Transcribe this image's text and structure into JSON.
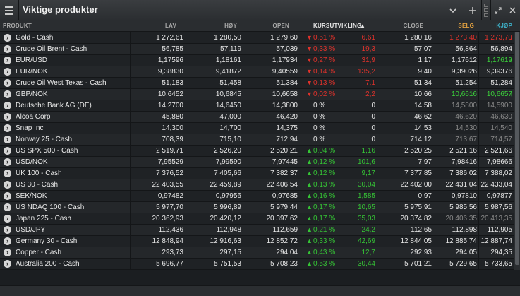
{
  "window": {
    "title": "Viktige produkter",
    "icons": [
      "menu-icon",
      "chevron-down-icon",
      "plus-icon",
      "expand-icon",
      "close-icon"
    ]
  },
  "columns": {
    "produkt": "PRODUKT",
    "lav": "LAV",
    "hoy": "HØY",
    "open": "OPEN",
    "kursutvikling": "KURSUTVIKLING",
    "close": "CLOSE",
    "selg": "SELG",
    "kjop": "KJØP"
  },
  "colors": {
    "up": "#35c435",
    "down": "#e0322b",
    "selg_header": "#e0a040",
    "kjop_header": "#3db0c8"
  },
  "rows": [
    {
      "name": "Gold - Cash",
      "lav": "1 272,61",
      "hoy": "1 280,50",
      "open": "1 279,60",
      "dir": "down",
      "pct": "0,51 %",
      "chg": "6,61",
      "close": "1 280,16",
      "selg": "1 273,40",
      "kjop": "1 273,70",
      "selg_state": "down",
      "kjop_state": "down"
    },
    {
      "name": "Crude Oil Brent - Cash",
      "lav": "56,785",
      "hoy": "57,119",
      "open": "57,039",
      "dir": "down",
      "pct": "0,33 %",
      "chg": "19,3",
      "close": "57,07",
      "selg": "56,864",
      "kjop": "56,894",
      "selg_state": "flat",
      "kjop_state": "flat"
    },
    {
      "name": "EUR/USD",
      "lav": "1,17596",
      "hoy": "1,18161",
      "open": "1,17934",
      "dir": "down",
      "pct": "0,27 %",
      "chg": "31,9",
      "close": "1,17",
      "selg": "1,17612",
      "kjop": "1,17619",
      "selg_state": "flat",
      "kjop_state": "up"
    },
    {
      "name": "EUR/NOK",
      "lav": "9,38830",
      "hoy": "9,41872",
      "open": "9,40559",
      "dir": "down",
      "pct": "0,14 %",
      "chg": "135,2",
      "close": "9,40",
      "selg": "9,39026",
      "kjop": "9,39376",
      "selg_state": "flat",
      "kjop_state": "flat"
    },
    {
      "name": "Crude Oil West Texas - Cash",
      "lav": "51,183",
      "hoy": "51,458",
      "open": "51,384",
      "dir": "down",
      "pct": "0,13 %",
      "chg": "7,1",
      "close": "51,34",
      "selg": "51,254",
      "kjop": "51,284",
      "selg_state": "flat",
      "kjop_state": "flat"
    },
    {
      "name": "GBP/NOK",
      "lav": "10,6452",
      "hoy": "10,6845",
      "open": "10,6658",
      "dir": "down",
      "pct": "0,02 %",
      "chg": "2,2",
      "close": "10,66",
      "selg": "10,6616",
      "kjop": "10,6657",
      "selg_state": "up",
      "kjop_state": "up"
    },
    {
      "name": "Deutsche Bank AG (DE)",
      "lav": "14,2700",
      "hoy": "14,6450",
      "open": "14,3800",
      "dir": "flat",
      "pct": "0 %",
      "chg": "0",
      "close": "14,58",
      "selg": "14,5800",
      "kjop": "14,5900",
      "selg_state": "mute",
      "kjop_state": "mute"
    },
    {
      "name": "Alcoa Corp",
      "lav": "45,880",
      "hoy": "47,000",
      "open": "46,420",
      "dir": "flat",
      "pct": "0 %",
      "chg": "0",
      "close": "46,62",
      "selg": "46,620",
      "kjop": "46,630",
      "selg_state": "mute",
      "kjop_state": "mute"
    },
    {
      "name": "Snap Inc",
      "lav": "14,300",
      "hoy": "14,700",
      "open": "14,375",
      "dir": "flat",
      "pct": "0 %",
      "chg": "0",
      "close": "14,53",
      "selg": "14,530",
      "kjop": "14,540",
      "selg_state": "mute",
      "kjop_state": "mute"
    },
    {
      "name": "Norway 25 - Cash",
      "lav": "708,39",
      "hoy": "715,10",
      "open": "712,94",
      "dir": "flat",
      "pct": "0 %",
      "chg": "0",
      "close": "714,12",
      "selg": "713,67",
      "kjop": "714,57",
      "selg_state": "mute",
      "kjop_state": "mute"
    },
    {
      "name": "US SPX 500 - Cash",
      "lav": "2 519,71",
      "hoy": "2 526,20",
      "open": "2 520,21",
      "dir": "up",
      "pct": "0,04 %",
      "chg": "1,16",
      "close": "2 520,25",
      "selg": "2 521,16",
      "kjop": "2 521,66",
      "selg_state": "flat",
      "kjop_state": "flat"
    },
    {
      "name": "USD/NOK",
      "lav": "7,95529",
      "hoy": "7,99590",
      "open": "7,97445",
      "dir": "up",
      "pct": "0,12 %",
      "chg": "101,6",
      "close": "7,97",
      "selg": "7,98416",
      "kjop": "7,98666",
      "selg_state": "flat",
      "kjop_state": "flat"
    },
    {
      "name": "UK 100 - Cash",
      "lav": "7 376,52",
      "hoy": "7 405,66",
      "open": "7 382,37",
      "dir": "up",
      "pct": "0,12 %",
      "chg": "9,17",
      "close": "7 377,85",
      "selg": "7 386,02",
      "kjop": "7 388,02",
      "selg_state": "flat",
      "kjop_state": "flat"
    },
    {
      "name": "US 30 - Cash",
      "lav": "22 403,55",
      "hoy": "22 459,89",
      "open": "22 406,54",
      "dir": "up",
      "pct": "0,13 %",
      "chg": "30,04",
      "close": "22 402,00",
      "selg": "22 431,04",
      "kjop": "22 433,04",
      "selg_state": "flat",
      "kjop_state": "flat"
    },
    {
      "name": "SEK/NOK",
      "lav": "0,97482",
      "hoy": "0,97956",
      "open": "0,97685",
      "dir": "up",
      "pct": "0,16 %",
      "chg": "1,585",
      "close": "0,97",
      "selg": "0,97810",
      "kjop": "0,97877",
      "selg_state": "flat",
      "kjop_state": "flat"
    },
    {
      "name": "US NDAQ 100 - Cash",
      "lav": "5 977,70",
      "hoy": "5 996,89",
      "open": "5 979,44",
      "dir": "up",
      "pct": "0,17 %",
      "chg": "10,65",
      "close": "5 975,91",
      "selg": "5 985,56",
      "kjop": "5 987,56",
      "selg_state": "flat",
      "kjop_state": "flat"
    },
    {
      "name": "Japan 225 - Cash",
      "lav": "20 362,93",
      "hoy": "20 420,12",
      "open": "20 397,62",
      "dir": "up",
      "pct": "0,17 %",
      "chg": "35,03",
      "close": "20 374,82",
      "selg": "20 406,35",
      "kjop": "20 413,35",
      "selg_state": "mute",
      "kjop_state": "mute"
    },
    {
      "name": "USD/JPY",
      "lav": "112,436",
      "hoy": "112,948",
      "open": "112,659",
      "dir": "up",
      "pct": "0,21 %",
      "chg": "24,2",
      "close": "112,65",
      "selg": "112,898",
      "kjop": "112,905",
      "selg_state": "flat",
      "kjop_state": "flat"
    },
    {
      "name": "Germany 30 - Cash",
      "lav": "12 848,94",
      "hoy": "12 916,63",
      "open": "12 852,72",
      "dir": "up",
      "pct": "0,33 %",
      "chg": "42,69",
      "close": "12 844,05",
      "selg": "12 885,74",
      "kjop": "12 887,74",
      "selg_state": "flat",
      "kjop_state": "flat"
    },
    {
      "name": "Copper - Cash",
      "lav": "293,73",
      "hoy": "297,15",
      "open": "294,04",
      "dir": "up",
      "pct": "0,43 %",
      "chg": "12,7",
      "close": "292,93",
      "selg": "294,05",
      "kjop": "294,35",
      "selg_state": "flat",
      "kjop_state": "flat"
    },
    {
      "name": "Australia 200 - Cash",
      "lav": "5 696,77",
      "hoy": "5 751,53",
      "open": "5 708,23",
      "dir": "up",
      "pct": "0,53 %",
      "chg": "30,44",
      "close": "5 701,21",
      "selg": "5 729,65",
      "kjop": "5 733,65",
      "selg_state": "flat",
      "kjop_state": "flat"
    }
  ]
}
